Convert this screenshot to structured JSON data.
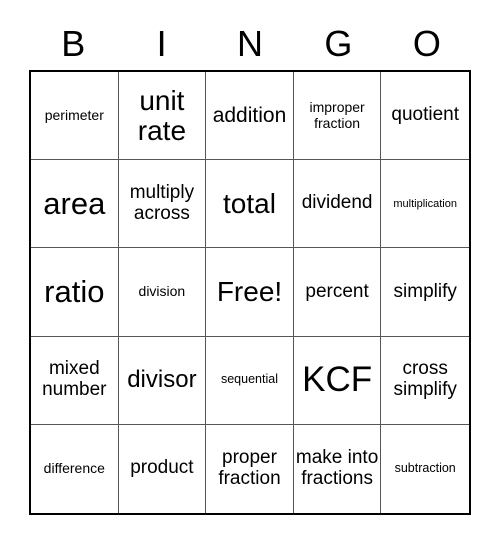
{
  "card": {
    "title": "BINGO",
    "header_letters": [
      "B",
      "I",
      "N",
      "G",
      "O"
    ],
    "columns": 5,
    "rows": 5,
    "free_space_label": "Free!",
    "free_space_position": "row3-col3",
    "colors": {
      "background": "#ffffff",
      "text": "#000000",
      "outer_border": "#000000",
      "grid_line": "#555555"
    }
  },
  "grid": {
    "rows": [
      {
        "index": 1,
        "cells": [
          {
            "column": "B",
            "text": "perimeter",
            "size": "fs-s"
          },
          {
            "column": "I",
            "text": "unit rate",
            "size": "fs-xl"
          },
          {
            "column": "N",
            "text": "addition",
            "size": "fs-ml"
          },
          {
            "column": "G",
            "text": "improper fraction",
            "size": "fs-s"
          },
          {
            "column": "O",
            "text": "quotient",
            "size": "fs-m"
          }
        ]
      },
      {
        "index": 2,
        "cells": [
          {
            "column": "B",
            "text": "area",
            "size": "fs-xxl"
          },
          {
            "column": "I",
            "text": "multiply across",
            "size": "fs-m"
          },
          {
            "column": "N",
            "text": "total",
            "size": "fs-xl"
          },
          {
            "column": "G",
            "text": "dividend",
            "size": "fs-m"
          },
          {
            "column": "O",
            "text": "multiplication",
            "size": "fs-xxs"
          }
        ]
      },
      {
        "index": 3,
        "cells": [
          {
            "column": "B",
            "text": "ratio",
            "size": "fs-xxl"
          },
          {
            "column": "I",
            "text": "division",
            "size": "fs-s"
          },
          {
            "column": "N",
            "text": "Free!",
            "size": "fs-xl"
          },
          {
            "column": "G",
            "text": "percent",
            "size": "fs-m"
          },
          {
            "column": "O",
            "text": "simplify",
            "size": "fs-m"
          }
        ]
      },
      {
        "index": 4,
        "cells": [
          {
            "column": "B",
            "text": "mixed number",
            "size": "fs-m"
          },
          {
            "column": "I",
            "text": "divisor",
            "size": "fs-l"
          },
          {
            "column": "N",
            "text": "sequential",
            "size": "fs-xs"
          },
          {
            "column": "G",
            "text": "KCF",
            "size": "fs-huge"
          },
          {
            "column": "O",
            "text": "cross simplify",
            "size": "fs-m"
          }
        ]
      },
      {
        "index": 5,
        "cells": [
          {
            "column": "B",
            "text": "difference",
            "size": "fs-s"
          },
          {
            "column": "I",
            "text": "product",
            "size": "fs-m"
          },
          {
            "column": "N",
            "text": "proper fraction",
            "size": "fs-m"
          },
          {
            "column": "G",
            "text": "make into fractions",
            "size": "fs-m"
          },
          {
            "column": "O",
            "text": "subtraction",
            "size": "fs-xs"
          }
        ]
      }
    ]
  }
}
